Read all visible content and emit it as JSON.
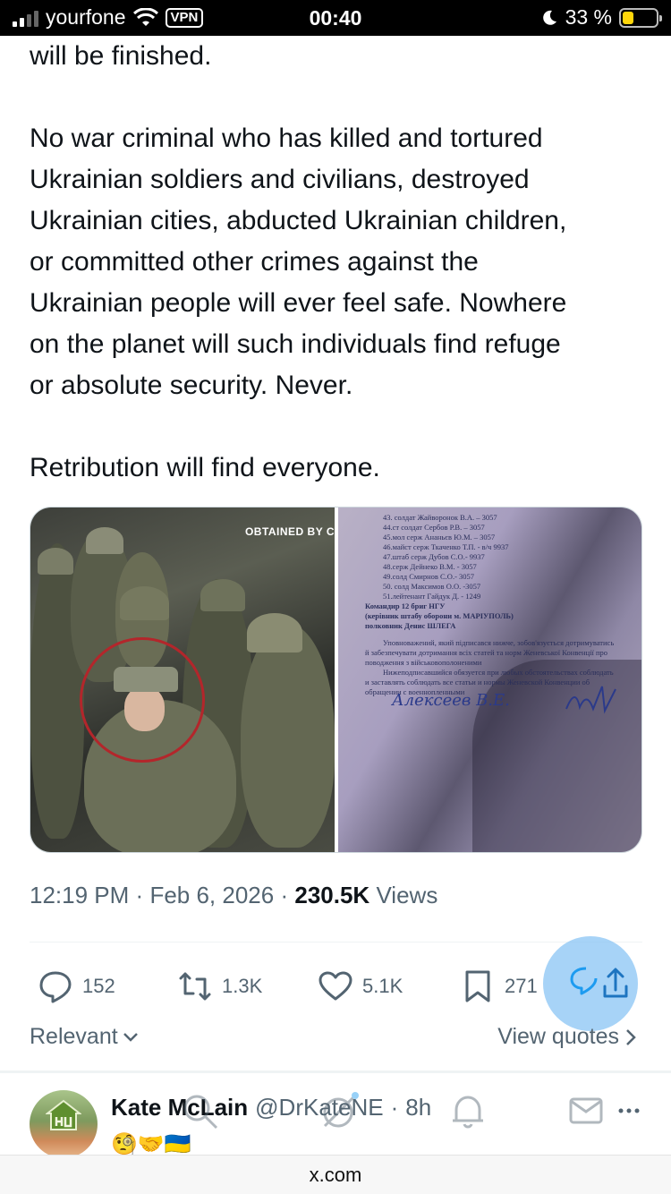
{
  "status_bar": {
    "carrier": "yourfone",
    "vpn": "VPN",
    "time": "00:40",
    "battery": "33 %",
    "battery_level": 0.33
  },
  "tweet": {
    "paragraphs": [
      "will be finished.",
      "No war criminal who has killed and tortured\nUkrainian soldiers and civilians, destroyed\nUkrainian cities, abducted Ukrainian children,\nor committed other crimes against the\nUkrainian people will ever feel safe. Nowhere\non the planet will such individuals find refuge\nor absolute security. Never.",
      "Retribution will find everyone."
    ],
    "media": {
      "left_watermark": "Obtained by C",
      "document_lines": [
        "43. солдат Жайворонок В.А. – 3057",
        "44.ст солдат Сербов Р.В. – 3057",
        "45.мол серж Ананьєв Ю.М. – 3057",
        "46.майст серж Ткаченко Т.П. -   в/ч 9937",
        "47.штаб серж Дубов С.О.- 9937",
        "48.серж Дейнеко В.М. - 3057",
        "49.солд Смирнов С.О.- 3057",
        "50. солд Максимов О.О. -3057",
        "51.лейтенант Гайдук Д. - 1249",
        "Командир 12 бриг НГУ",
        "(керівник штабу оборони м. МАРІУПОЛЬ)",
        "полковник                                   Денис ШЛЕГА",
        "Уповноважений, який підписався нижче, зобов'язується дотримуватись",
        "й забезпечувати дотримання всіх статей та норм Женевської Конвенції про",
        "поводження з військовополоненими",
        "Нижеподписавшийся обязуется при любых обстоятельствах соблюдать",
        "и заставлять соблюдать все статьи и нормы Женевской Конвенции об",
        "обращении с военнопленными"
      ],
      "signature_text": "Алексеев В.Е."
    },
    "time": "12:19 PM",
    "date": "Feb 6, 2026",
    "views_count": "230.5K",
    "views_label": "Views",
    "separator": "·"
  },
  "actions": {
    "replies": "152",
    "reposts": "1.3K",
    "likes": "5.1K",
    "bookmarks": "271"
  },
  "sort": {
    "relevant_label": "Relevant",
    "view_quotes_label": "View quotes"
  },
  "reply_preview": {
    "name": "Kate McLain",
    "handle": "@DrKateNE",
    "separator": "·",
    "age": "8h",
    "emojis": "🧐🤝🇺🇦"
  },
  "url_bar": {
    "url": "x.com"
  },
  "colors": {
    "text_primary": "#0f1419",
    "text_secondary": "#536471",
    "share_bubble": "#8ac4f4",
    "accent_blue": "#1d9bf0"
  }
}
